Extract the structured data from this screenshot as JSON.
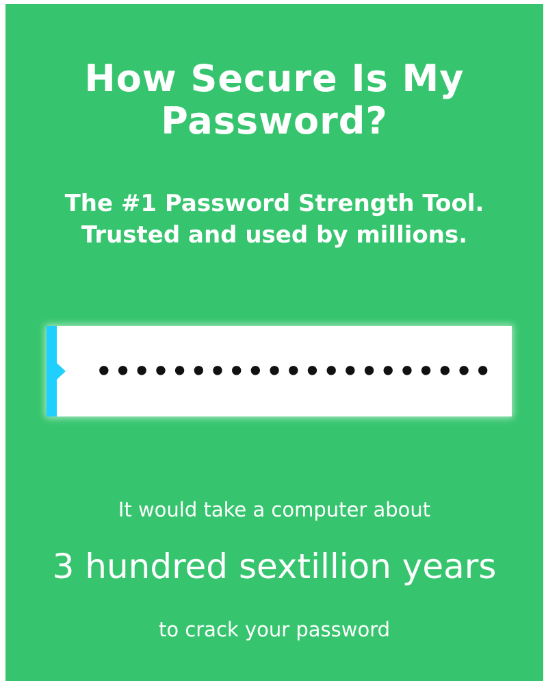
{
  "header": {
    "title_line1": "How Secure Is My",
    "title_line2": "Password?",
    "subtitle_line1": "The #1 Password Strength Tool.",
    "subtitle_line2": "Trusted and used by millions."
  },
  "password_field": {
    "value": "•••••••••••••••••••••"
  },
  "result": {
    "prefix": "It would take a computer about",
    "time": "3 hundred sextillion years",
    "suffix": "to crack your password"
  },
  "colors": {
    "background": "#36c56e",
    "text": "#ffffff",
    "accent_strip": "#1fd0ff",
    "input_bg": "#ffffff"
  }
}
